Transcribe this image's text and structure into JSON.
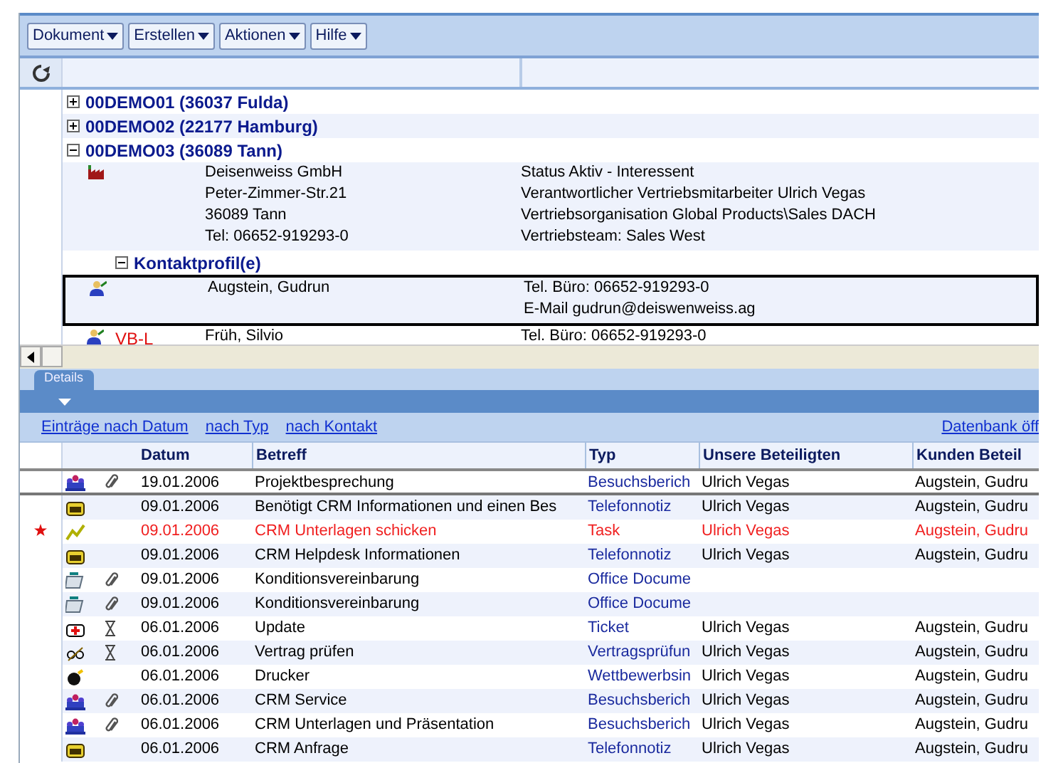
{
  "toolbar": [
    {
      "label": "Dokument"
    },
    {
      "label": "Erstellen"
    },
    {
      "label": "Aktionen"
    },
    {
      "label": "Hilfe"
    }
  ],
  "tree": [
    {
      "label": "00DEMO01 (36037 Fulda)",
      "expanded": false
    },
    {
      "label": "00DEMO02 (22177 Hamburg)",
      "expanded": false
    },
    {
      "label": "00DEMO03 (36089 Tann)",
      "expanded": true,
      "details": {
        "left": [
          "Deisenweiss GmbH",
          "Peter-Zimmer-Str.21",
          "36089 Tann",
          "Tel: 06652-919293-0"
        ],
        "right": [
          "Status Aktiv - Interessent",
          "Verantwortlicher Vertriebsmitarbeiter Ulrich Vegas",
          "Vertriebsorganisation Global Products\\Sales DACH",
          "Vertriebsteam: Sales West"
        ]
      },
      "children": [
        {
          "label": "Kontaktprofil(e)",
          "expanded": true,
          "contacts": [
            {
              "name": "Augstein, Gudrun",
              "lines": [
                "Tel. Büro: 06652-919293-0",
                "E-Mail gudrun@deiswenweiss.ag"
              ],
              "selected": true
            },
            {
              "role": "VB-L",
              "name": "Früh, Silvio",
              "lines": [
                "Tel. Büro: 06652-919293-0"
              ],
              "selected": false
            }
          ]
        }
      ]
    }
  ],
  "tabs": [
    {
      "label": "Details",
      "selected": true
    }
  ],
  "links": [
    "Einträge nach Datum",
    "nach Typ",
    "nach Kontakt"
  ],
  "right_link": "Datenbank öff",
  "columns": [
    "Datum",
    "Betreff",
    "Typ",
    "Unsere Beteiligten",
    "Kunden Beteil"
  ],
  "rows": [
    {
      "kind": "meeting",
      "attachment": true,
      "pending": false,
      "flagged": false,
      "selected": true,
      "date": "19.01.2006",
      "subject": "Projektbesprechung",
      "type": "Besuchsberich",
      "ours": "Ulrich Vegas",
      "customer": "Augstein, Gudru"
    },
    {
      "kind": "phone",
      "attachment": false,
      "pending": false,
      "flagged": false,
      "selected": false,
      "date": "09.01.2006",
      "subject": "Benötigt CRM Informationen und einen Bes",
      "type": "Telefonnotiz",
      "ours": "Ulrich Vegas",
      "customer": "Augstein, Gudru"
    },
    {
      "kind": "task",
      "attachment": false,
      "pending": false,
      "flagged": true,
      "selected": false,
      "date": "09.01.2006",
      "subject": "CRM Unterlagen schicken",
      "type": "Task",
      "ours": "Ulrich Vegas",
      "customer": "Augstein, Gudru"
    },
    {
      "kind": "phone",
      "attachment": false,
      "pending": false,
      "flagged": false,
      "selected": false,
      "date": "09.01.2006",
      "subject": "CRM Helpdesk Informationen",
      "type": "Telefonnotiz",
      "ours": "Ulrich Vegas",
      "customer": "Augstein, Gudru"
    },
    {
      "kind": "document",
      "attachment": true,
      "pending": false,
      "flagged": false,
      "selected": false,
      "date": "09.01.2006",
      "subject": "Konditionsvereinbarung",
      "type": "Office Docume"
    },
    {
      "kind": "document",
      "attachment": true,
      "pending": false,
      "flagged": false,
      "selected": false,
      "date": "09.01.2006",
      "subject": "Konditionsvereinbarung",
      "type": "Office Docume"
    },
    {
      "kind": "ticket",
      "attachment": false,
      "pending": true,
      "flagged": false,
      "selected": false,
      "date": "06.01.2006",
      "subject": "Update",
      "type": "Ticket",
      "ours": "Ulrich Vegas",
      "customer": "Augstein, Gudru"
    },
    {
      "kind": "contract",
      "attachment": false,
      "pending": true,
      "flagged": false,
      "selected": false,
      "date": "06.01.2006",
      "subject": "Vertrag prüfen",
      "type": "Vertragsprüfun",
      "ours": "Ulrich Vegas",
      "customer": "Augstein, Gudru"
    },
    {
      "kind": "competitor",
      "attachment": false,
      "pending": false,
      "flagged": false,
      "selected": false,
      "date": "06.01.2006",
      "subject": "Drucker",
      "type": "Wettbewerbsin",
      "ours": "Ulrich Vegas",
      "customer": "Augstein, Gudru"
    },
    {
      "kind": "meeting",
      "attachment": true,
      "pending": false,
      "flagged": false,
      "selected": false,
      "date": "06.01.2006",
      "subject": "CRM Service",
      "type": "Besuchsberich",
      "ours": "Ulrich Vegas",
      "customer": "Augstein, Gudru"
    },
    {
      "kind": "meeting",
      "attachment": true,
      "pending": false,
      "flagged": false,
      "selected": false,
      "date": "06.01.2006",
      "subject": "CRM Unterlagen und Präsentation",
      "type": "Besuchsberich",
      "ours": "Ulrich Vegas",
      "customer": "Augstein, Gudru"
    },
    {
      "kind": "phone",
      "attachment": false,
      "pending": false,
      "flagged": false,
      "selected": false,
      "date": "06.01.2006",
      "subject": "CRM Anfrage",
      "type": "Telefonnotiz",
      "ours": "Ulrich Vegas",
      "customer": "Augstein, Gudru"
    }
  ]
}
